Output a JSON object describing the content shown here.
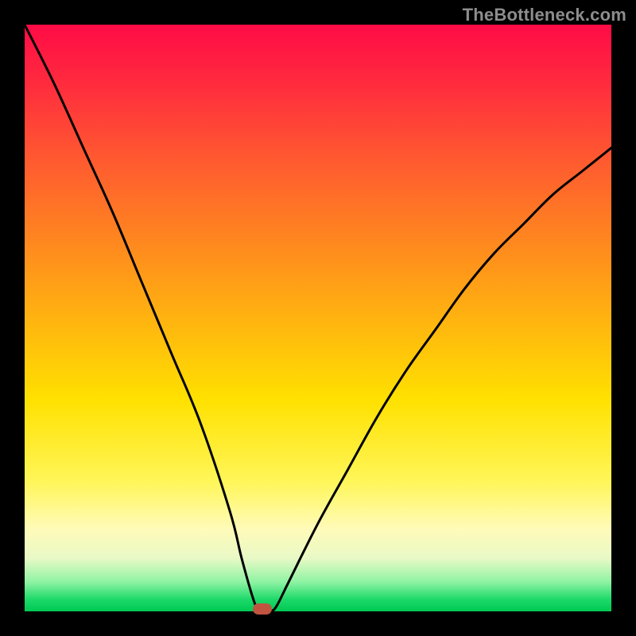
{
  "watermark": "TheBottleneck.com",
  "chart_data": {
    "type": "line",
    "title": "",
    "xlabel": "",
    "ylabel": "",
    "xlim": [
      0,
      100
    ],
    "ylim": [
      0,
      100
    ],
    "grid": false,
    "series": [
      {
        "name": "bottleneck-curve",
        "x": [
          0,
          5,
          10,
          15,
          20,
          25,
          30,
          35,
          37,
          39,
          40,
          41,
          42,
          43,
          45,
          50,
          55,
          60,
          65,
          70,
          75,
          80,
          85,
          90,
          95,
          100
        ],
        "y": [
          100,
          90,
          79,
          68,
          56,
          44,
          32,
          17,
          9,
          2,
          0,
          0,
          0,
          1,
          5,
          15,
          24,
          33,
          41,
          48,
          55,
          61,
          66,
          71,
          75,
          79
        ]
      }
    ],
    "marker": {
      "x": 40.5,
      "y": 0
    },
    "colors": {
      "curve": "#000000",
      "marker": "#c1543f",
      "gradient_top": "#ff0b46",
      "gradient_bottom": "#00c853"
    }
  }
}
